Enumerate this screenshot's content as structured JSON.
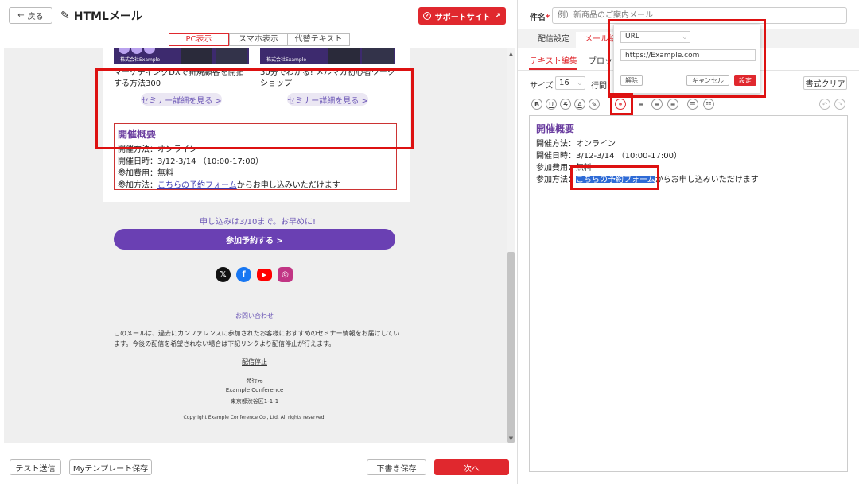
{
  "header": {
    "back_label": "戻る",
    "title": "HTMLメール",
    "support_label": "サポートサイト"
  },
  "view_tabs": [
    {
      "label": "PC表示",
      "active": true
    },
    {
      "label": "スマホ表示",
      "active": false
    },
    {
      "label": "代替テキスト",
      "active": false
    }
  ],
  "preview": {
    "articles": [
      {
        "company": "株式会社Example",
        "title": "マーケティングDXで新規顧客を開拓する方法300",
        "button": "セミナー詳細を見る >"
      },
      {
        "company": "株式会社Example",
        "title": "30分でわかる! メルマガ初心者ワークショップ",
        "button": "セミナー詳細を見る >"
      }
    ],
    "event": {
      "title": "開催概要",
      "method": "開催方法：オンライン",
      "date": "開催日時：3/12-3/14 （10:00-17:00）",
      "fee": "参加費用：無料",
      "apply_prefix": "参加方法：",
      "apply_link": "こちらの予約フォーム",
      "apply_suffix": "からお申し込みいただけます"
    },
    "deadline": "申し込みは3/10まで。お早めに!",
    "join_button": "参加予約する >",
    "contact_link": "お問い合わせ",
    "notice": "このメールは、過去にカンファレンスに参加されたお客様におすすめのセミナー情報をお届けしています。今後の配信を希望されない場合は下記リンクより配信停止が行えます。",
    "unsubscribe": "配信停止",
    "publisher_label": "発行元",
    "publisher_name": "Example Conference",
    "publisher_address": "東京都渋谷区1-1-1",
    "copyright": "Copyright Example Conference Co., Ltd. All rights reserved."
  },
  "footer_buttons": {
    "test_send": "テスト送信",
    "save_template": "Myテンプレート保存",
    "save_draft": "下書き保存",
    "next": "次へ"
  },
  "right": {
    "subject_label": "件名",
    "subject_required": "*",
    "subject_placeholder": "例）新商品のご案内メール",
    "tabs": [
      "配信設定",
      "メール編"
    ],
    "subtabs": [
      "テキスト編集",
      "ブロッ"
    ],
    "size_label": "サイズ",
    "size_value": "16",
    "line_label": "行間",
    "clear_format": "書式クリア",
    "editor": {
      "title": "開催概要",
      "method": "開催方法：オンライン",
      "date": "開催日時：3/12-3/14 （10:00-17:00）",
      "fee": "参加費用：無料",
      "apply_prefix": "参加方法：",
      "apply_link": "こちらの予約フォーム",
      "apply_suffix": "からお申し込みいただけます"
    },
    "link_popup": {
      "type": "URL",
      "url": "https://Example.com",
      "remove": "解除",
      "cancel": "キャンセル",
      "set": "設定"
    }
  },
  "colors": {
    "accent_red": "#e0282e",
    "purple": "#6a40b3",
    "highlight": "#dd1111"
  }
}
